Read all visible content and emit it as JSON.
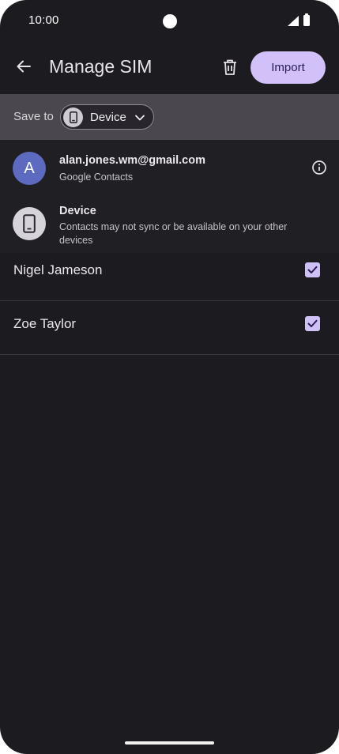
{
  "status_bar": {
    "time": "10:00"
  },
  "app_bar": {
    "title": "Manage SIM",
    "import_label": "Import"
  },
  "save_to": {
    "label": "Save to",
    "selected": "Device"
  },
  "accounts": [
    {
      "avatar_letter": "A",
      "title": "alan.jones.wm@gmail.com",
      "subtitle": "Google Contacts",
      "avatar_color": "#5c6bc0"
    },
    {
      "title": "Device",
      "subtitle": "Contacts may not sync or be available on your other devices"
    }
  ],
  "contacts": [
    {
      "name": "Nigel Jameson",
      "checked": true
    },
    {
      "name": "Zoe Taylor",
      "checked": true
    }
  ],
  "colors": {
    "accent": "#d1c1f8",
    "checkbox": "#cfc1f6",
    "background": "#1c1b20"
  }
}
